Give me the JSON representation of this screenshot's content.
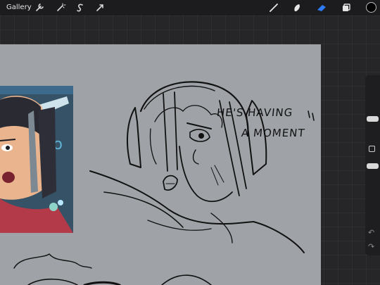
{
  "topbar": {
    "gallery_label": "Gallery",
    "left_tools": [
      "wrench-icon",
      "magic-wand-icon",
      "selection-icon",
      "transform-arrow-icon"
    ],
    "right_tools": [
      "brush-icon",
      "smudge-icon",
      "eraser-icon",
      "layers-icon"
    ],
    "active_tool": "eraser",
    "accent_color": "#2f7bf5",
    "current_color": "#000000"
  },
  "canvas": {
    "background_color": "#9fa3a8",
    "caption_line1": "HE'S HAVING",
    "caption_line2": "A MOMENT",
    "caption_trailing_mark": "/;"
  },
  "sidebar": {
    "brush_size_slider": 0.25,
    "opacity_slider": 0.55,
    "undo_icon": "undo-icon",
    "redo_icon": "redo-icon"
  }
}
